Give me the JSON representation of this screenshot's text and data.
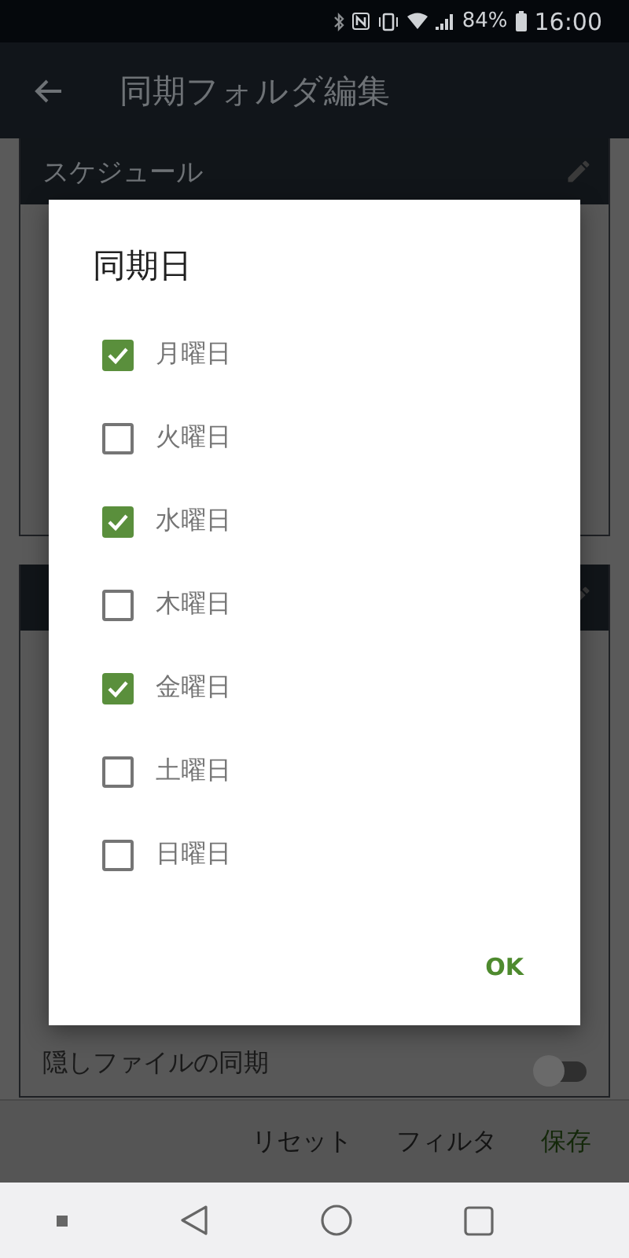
{
  "status_bar": {
    "battery": "84%",
    "time": "16:00"
  },
  "app_bar": {
    "title": "同期フォルダ編集"
  },
  "schedule_card": {
    "title": "スケジュール"
  },
  "hidden_files": {
    "label": "隠しファイルの同期",
    "on": false
  },
  "dialog": {
    "title": "同期日",
    "days": [
      {
        "label": "月曜日",
        "checked": true
      },
      {
        "label": "火曜日",
        "checked": false
      },
      {
        "label": "水曜日",
        "checked": true
      },
      {
        "label": "木曜日",
        "checked": false
      },
      {
        "label": "金曜日",
        "checked": true
      },
      {
        "label": "土曜日",
        "checked": false
      },
      {
        "label": "日曜日",
        "checked": false
      }
    ],
    "ok": "OK"
  },
  "bottom_bar": {
    "buttons": [
      {
        "label": "リセット",
        "kind": "plain"
      },
      {
        "label": "フィルタ",
        "kind": "plain"
      },
      {
        "label": "保存",
        "kind": "primary"
      }
    ]
  }
}
